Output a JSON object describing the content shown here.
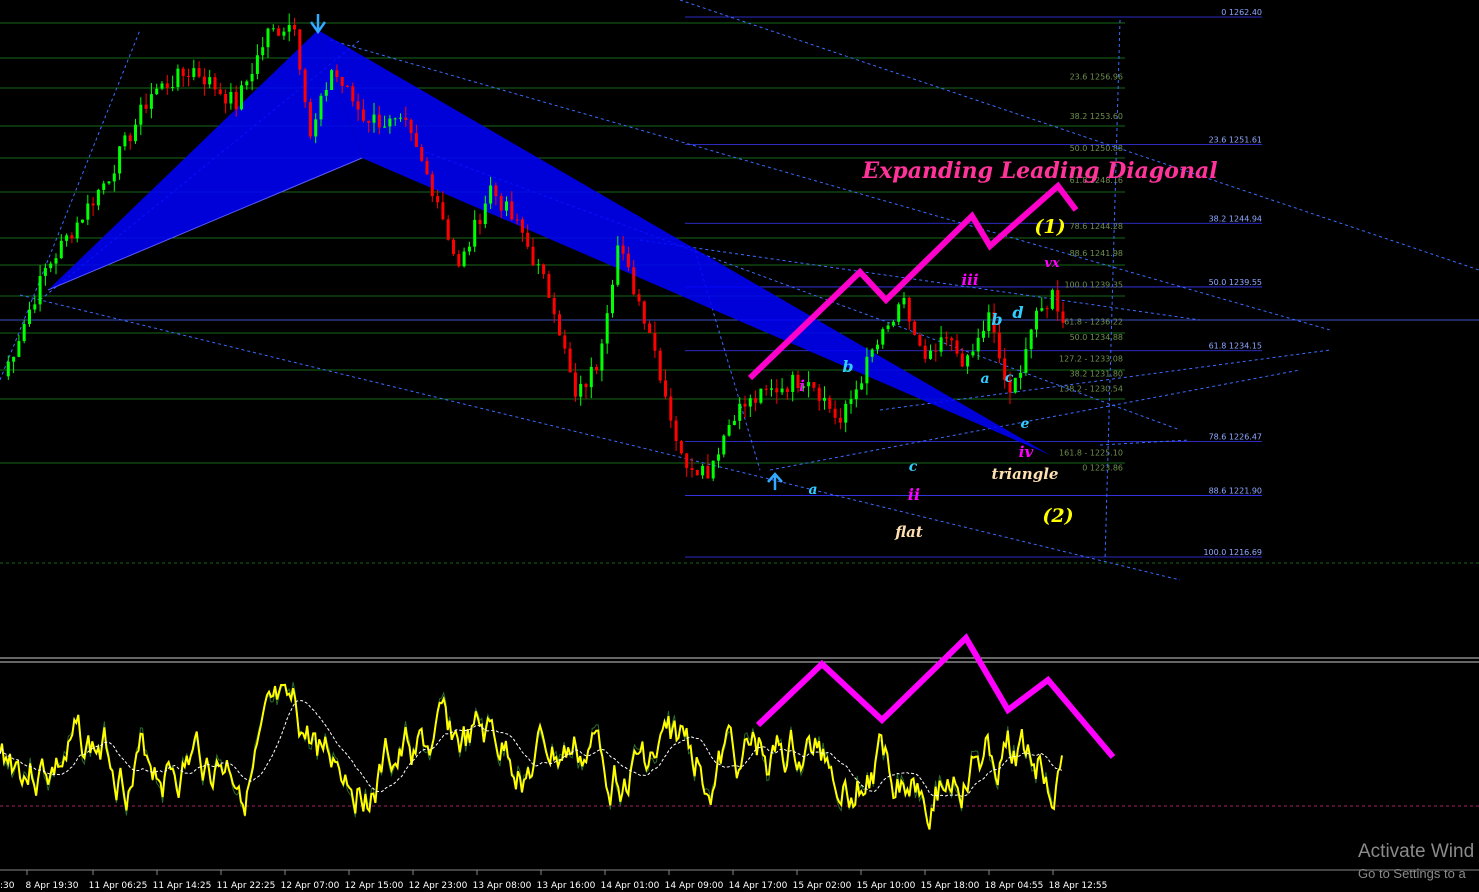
{
  "chart_data": [
    {
      "type": "candlestick",
      "panel": "main",
      "title": "Expanding Leading Diagonal",
      "colors": {
        "up": "#00ff00",
        "down": "#ff0000",
        "background": "#000000",
        "harmonic": "#0000ff",
        "diagonal": "#ff00cc",
        "annot": "#ffff00"
      },
      "ylim": [
        1214.5,
        1264.5
      ],
      "x_ticks": [
        "8 Apr 19:30",
        "11 Apr 06:25",
        "11 Apr 14:25",
        "11 Apr 22:25",
        "12 Apr 07:00",
        "12 Apr 15:00",
        "12 Apr 23:00",
        "13 Apr 08:00",
        "13 Apr 16:00",
        "14 Apr 01:00",
        "14 Apr 09:00",
        "14 Apr 17:00",
        "15 Apr 02:00",
        "15 Apr 10:00",
        "15 Apr 18:00",
        "18 Apr 04:55",
        "18 Apr 12:55"
      ],
      "x_tick_partial": ":30",
      "price_path": [
        {
          "bar": 0,
          "price": 1232
        },
        {
          "bar": 8,
          "price": 1241
        },
        {
          "bar": 14,
          "price": 1245
        },
        {
          "bar": 20,
          "price": 1249
        },
        {
          "bar": 28,
          "price": 1256
        },
        {
          "bar": 36,
          "price": 1258
        },
        {
          "bar": 44,
          "price": 1255
        },
        {
          "bar": 50,
          "price": 1261
        },
        {
          "bar": 55,
          "price": 1262
        },
        {
          "bar": 58,
          "price": 1252
        },
        {
          "bar": 62,
          "price": 1258
        },
        {
          "bar": 68,
          "price": 1254
        },
        {
          "bar": 76,
          "price": 1253
        },
        {
          "bar": 82,
          "price": 1247
        },
        {
          "bar": 86,
          "price": 1241
        },
        {
          "bar": 92,
          "price": 1248
        },
        {
          "bar": 98,
          "price": 1244
        },
        {
          "bar": 104,
          "price": 1238
        },
        {
          "bar": 108,
          "price": 1230
        },
        {
          "bar": 112,
          "price": 1233
        },
        {
          "bar": 116,
          "price": 1243
        },
        {
          "bar": 122,
          "price": 1236
        },
        {
          "bar": 128,
          "price": 1225
        },
        {
          "bar": 133,
          "price": 1224
        },
        {
          "bar": 138,
          "price": 1229
        },
        {
          "bar": 146,
          "price": 1231
        },
        {
          "bar": 152,
          "price": 1232
        },
        {
          "bar": 158,
          "price": 1228
        },
        {
          "bar": 164,
          "price": 1234
        },
        {
          "bar": 170,
          "price": 1238
        },
        {
          "bar": 174,
          "price": 1233
        },
        {
          "bar": 178,
          "price": 1235
        },
        {
          "bar": 182,
          "price": 1233
        },
        {
          "bar": 186,
          "price": 1237
        },
        {
          "bar": 190,
          "price": 1230
        },
        {
          "bar": 194,
          "price": 1236
        },
        {
          "bar": 198,
          "price": 1239
        },
        {
          "bar": 200,
          "price": 1237
        }
      ],
      "levels_right": [
        {
          "label": "0 1262.40",
          "price": 1262.4
        },
        {
          "label": "23.6 1251.61",
          "price": 1251.61
        },
        {
          "label": "38.2 1244.94",
          "price": 1244.94
        },
        {
          "label": "50.0 1239.55",
          "price": 1239.55
        },
        {
          "label": "61.8 1234.15",
          "price": 1234.15
        },
        {
          "label": "78.6 1226.47",
          "price": 1226.47
        },
        {
          "label": "88.6 1221.90",
          "price": 1221.9
        },
        {
          "label": "100.0 1216.69",
          "price": 1216.69
        }
      ],
      "levels_mid": [
        {
          "label": "23.6 1256.96",
          "price": 1256.96
        },
        {
          "label": "38.2 1253.60",
          "price": 1253.6
        },
        {
          "label": "50.0 1250.88",
          "price": 1250.88
        },
        {
          "label": "61.8 1248.16",
          "price": 1248.16
        },
        {
          "label": "78.6 1244.28",
          "price": 1244.28
        },
        {
          "label": "88.6 1241.98",
          "price": 1241.98
        },
        {
          "label": "100.0 1239.35",
          "price": 1239.35
        },
        {
          "label": "61.8 - 1236.22",
          "price": 1236.22
        },
        {
          "label": "50.0 1234.88",
          "price": 1234.88
        },
        {
          "label": "127.2 - 1233.08",
          "price": 1233.08
        },
        {
          "label": "38.2 1231.80",
          "price": 1231.8
        },
        {
          "label": "138.2 - 1230.54",
          "price": 1230.54
        },
        {
          "label": "161.8 - 1225.10",
          "price": 1225.1
        },
        {
          "label": "0 1223.86",
          "price": 1223.86
        }
      ],
      "annotations": [
        {
          "text": "Expanding Leading Diagonal",
          "color": "#ff3399"
        },
        {
          "text": "(1)",
          "color": "#ffff00"
        },
        {
          "text": "(2)",
          "color": "#ffff00"
        },
        {
          "text": "vx",
          "color": "#ff00ff"
        },
        {
          "text": "iii",
          "color": "#ff00ff"
        },
        {
          "text": "i",
          "color": "#ff00ff"
        },
        {
          "text": "ii",
          "color": "#ff00ff"
        },
        {
          "text": "iv",
          "color": "#ff00ff"
        },
        {
          "text": "a",
          "color": "#33ccff"
        },
        {
          "text": "b",
          "color": "#33ccff"
        },
        {
          "text": "c",
          "color": "#33ccff"
        },
        {
          "text": "a",
          "color": "#33ccff"
        },
        {
          "text": "b",
          "color": "#33ccff"
        },
        {
          "text": "c",
          "color": "#33ccff"
        },
        {
          "text": "d",
          "color": "#33ccff"
        },
        {
          "text": "e",
          "color": "#33ccff"
        },
        {
          "text": "flat",
          "color": "#ffe0b0"
        },
        {
          "text": "triangle",
          "color": "#ffe0b0"
        }
      ]
    },
    {
      "type": "line",
      "panel": "oscillator",
      "series": [
        {
          "color": "#ffff00"
        },
        {
          "color": "#ffffff",
          "style": "dashed"
        },
        {
          "color": "#ff00ff",
          "style": "zigzag"
        }
      ]
    }
  ],
  "watermark": {
    "line1": "Activate Wind",
    "line2": "Go to Settings to a"
  }
}
